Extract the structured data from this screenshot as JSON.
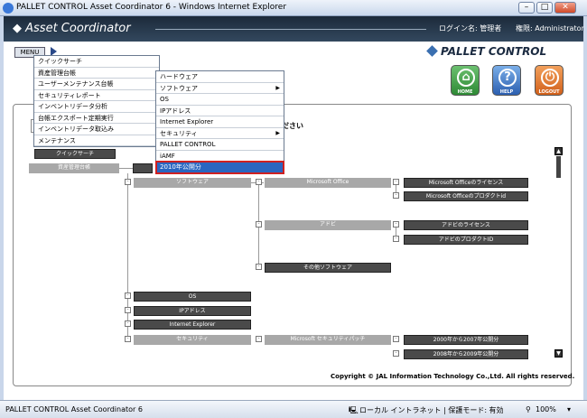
{
  "window": {
    "title": "PALLET CONTROL Asset Coordinator 6 - Windows Internet Explorer",
    "min": "–",
    "max": "□",
    "close": "✕"
  },
  "header": {
    "logo": "Asset Coordinator",
    "login": "ログイン名: 管理者",
    "role": "権限: Administrator"
  },
  "menu_label": "MENU",
  "brand": "PALLET CONTROL",
  "buttons": {
    "home": "HOME",
    "help": "HELP",
    "logout": "LOGOUT",
    "home_icon": "⌂",
    "help_icon": "?",
    "logout_icon": "⏻"
  },
  "main_menu": [
    "クイックサーチ",
    "資産管理台帳",
    "ユーザーメンテナンス台帳",
    "セキュリティレポート",
    "インベントリデータ分析",
    "台帳エクスポート定期実行",
    "インベントリデータ取込み",
    "メンテナンス"
  ],
  "sub_menu": [
    "ハードウェア",
    "ソフトウェア",
    "OS",
    "IPアドレス",
    "Internet Explorer",
    "セキュリティ",
    "PALLET CONTROL",
    "iAMF",
    "2010年公開分"
  ],
  "sub_arrows": [
    "▶",
    "▶"
  ],
  "bg_hint": "ださい",
  "tree": {
    "quick": "クイックサーチ",
    "ledger": "資産管理台帳",
    "software": "ソフトウェア",
    "msoffice": "Microsoft Office",
    "ms_license": "Microsoft Officeのライセンス",
    "ms_product": "Microsoft Officeのプロダクトid",
    "adobe": "アドビ",
    "adobe_license": "アドビのライセンス",
    "adobe_product": "アドビのプロダクトID",
    "other_sw": "その他ソフトウェア",
    "os": "OS",
    "ip": "IPアドレス",
    "ie": "Internet Explorer",
    "security": "セキュリティ",
    "ms_patch": "Microsoft セキュリティパッチ",
    "y2000": "2000年から2007年公開分",
    "y2008": "2008年から2009年公開分"
  },
  "scroll": {
    "up": "▲",
    "down": "▼"
  },
  "copyright": "Copyright © JAL Information Technology Co.,Ltd. All rights reserved.",
  "status": {
    "left": "PALLET CONTROL Asset Coordinator 6",
    "zone": "ローカル イントラネット | 保護モード: 有効",
    "zoom": "100%",
    "zoom_icon": "⚲",
    "arrow": "▾"
  }
}
